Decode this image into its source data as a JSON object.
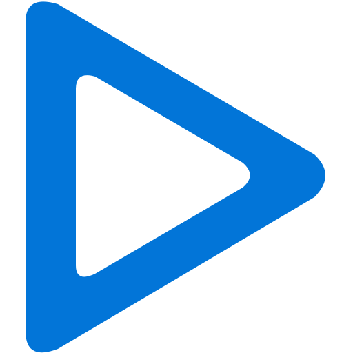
{
  "icon": {
    "name": "play-icon",
    "color": "#0275D8",
    "background": "#FFFFFF",
    "style": "outlined rounded triangle pointing right"
  }
}
